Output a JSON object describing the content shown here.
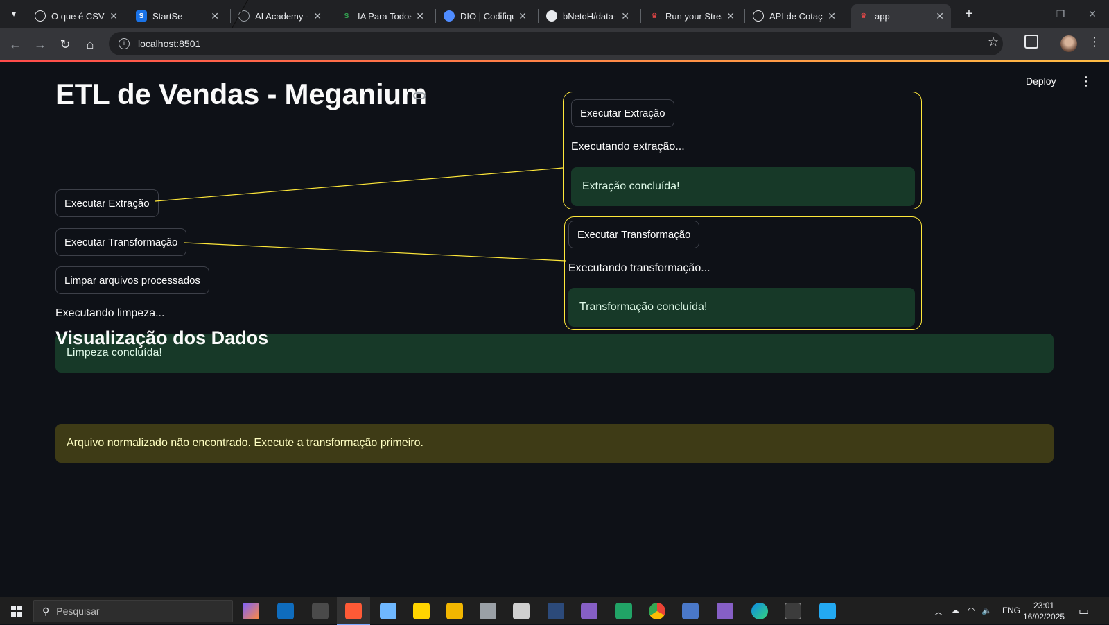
{
  "browser": {
    "tabs": [
      {
        "label": "O que é CSV",
        "icon": "chatgpt-icon",
        "color": "#e8eaed"
      },
      {
        "label": "StartSe",
        "icon": "startse-icon",
        "color": "#1a73e8"
      },
      {
        "label": "AI Academy -",
        "icon": "globe-icon",
        "color": "#9aa0a6"
      },
      {
        "label": "IA Para Todos |",
        "icon": "s-logo-icon",
        "color": "#34a853"
      },
      {
        "label": "DIO | Codifiqu",
        "icon": "dio-icon",
        "color": "#4f8cff"
      },
      {
        "label": "bNetoH/data-",
        "icon": "github-icon",
        "color": "#e8eaed"
      },
      {
        "label": "Run your Strea",
        "icon": "streamlit-icon",
        "color": "#ff4b4b"
      },
      {
        "label": "API de Cotaçõ",
        "icon": "chatgpt-icon",
        "color": "#e8eaed"
      },
      {
        "label": "app",
        "icon": "streamlit-icon",
        "color": "#ff4b4b"
      }
    ],
    "url": "localhost:8501"
  },
  "app": {
    "deploy_label": "Deploy",
    "title": "ETL de Vendas - Meganium",
    "buttons": {
      "extract": "Executar Extração",
      "transform": "Executar Transformação",
      "clean": "Limpar arquivos processados"
    },
    "cleaning_status": "Executando limpeza...",
    "cleaning_success": "Limpeza concluída!",
    "data_header": "Visualização dos Dados",
    "warning": "Arquivo normalizado não encontrado. Execute a transformação primeiro."
  },
  "callouts": {
    "extract": {
      "button": "Executar Extração",
      "status": "Executando extração...",
      "success": "Extração concluída!"
    },
    "transform": {
      "button": "Executar Transformação",
      "status": "Executando transformação...",
      "success": "Transformação concluída!"
    },
    "border_color": "#ffe83a"
  },
  "taskbar": {
    "search_placeholder": "Pesquisar",
    "language": "ENG",
    "time": "23:01",
    "date": "16/02/2025"
  }
}
